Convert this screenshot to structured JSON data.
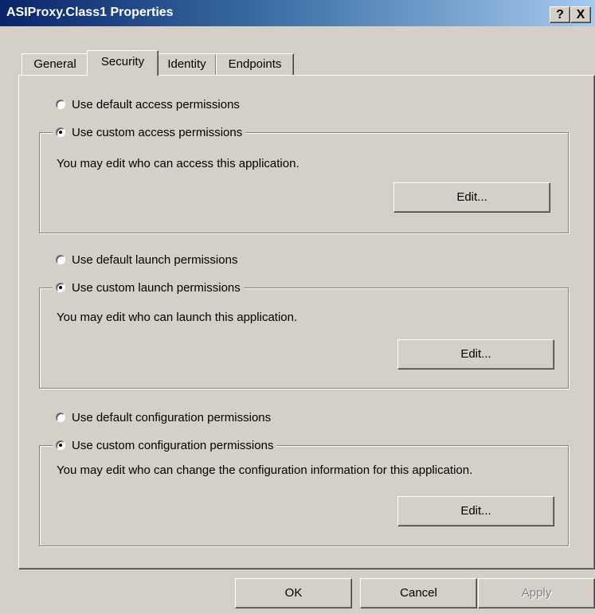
{
  "window": {
    "title": "ASIProxy.Class1 Properties",
    "help_label": "?",
    "close_label": "X"
  },
  "tabs": [
    {
      "label": "General",
      "active": false
    },
    {
      "label": "Security",
      "active": true
    },
    {
      "label": "Identity",
      "active": false
    },
    {
      "label": "Endpoints",
      "active": false
    }
  ],
  "access": {
    "default_label": "Use default access permissions",
    "custom_label": "Use custom access permissions",
    "selected": "custom",
    "description": "You may edit who can access this application.",
    "edit_label": "Edit..."
  },
  "launch": {
    "default_label": "Use default launch permissions",
    "custom_label": "Use custom launch permissions",
    "selected": "custom",
    "description": "You may edit who can launch this application.",
    "edit_label": "Edit..."
  },
  "configuration": {
    "default_label": "Use default configuration permissions",
    "custom_label": "Use custom configuration permissions",
    "selected": "custom",
    "description": "You may edit who can change the configuration information for this application.",
    "edit_label": "Edit..."
  },
  "footer": {
    "ok_label": "OK",
    "cancel_label": "Cancel",
    "apply_label": "Apply",
    "apply_enabled": false
  },
  "colors": {
    "titlebar_start": "#0a246a",
    "titlebar_end": "#a6caf0",
    "face": "#d4d0c8",
    "disabled_text": "#808080"
  }
}
